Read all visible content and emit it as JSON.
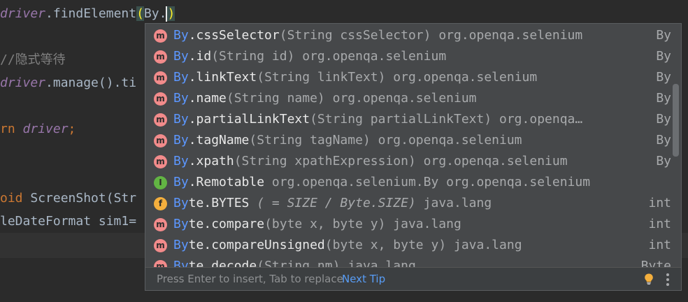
{
  "editor": {
    "lines": [
      {
        "prefix": "driver",
        "middle": ".findElement",
        "paren": "(",
        "after": "By."
      },
      {
        "comment": "//隐式等待"
      },
      {
        "prefix": "driver",
        "middle": ".manage().ti"
      },
      {
        "kw": "rn ",
        "var": "driver",
        "end": ";"
      },
      {
        "kw": "oid ",
        "rest": "ScreenShot(Str"
      },
      {
        "rest": "leDateFormat sim1="
      }
    ]
  },
  "completion": {
    "items": [
      {
        "icon": "m",
        "match": "By",
        "name": ".cssSelector",
        "sig": "(String cssSelector)",
        "tail": " org.openqa.selenium",
        "type": "By"
      },
      {
        "icon": "m",
        "match": "By",
        "name": ".id",
        "sig": "(String id)",
        "tail": " org.openqa.selenium",
        "type": "By"
      },
      {
        "icon": "m",
        "match": "By",
        "name": ".linkText",
        "sig": "(String linkText)",
        "tail": " org.openqa.selenium",
        "type": "By"
      },
      {
        "icon": "m",
        "match": "By",
        "name": ".name",
        "sig": "(String name)",
        "tail": " org.openqa.selenium",
        "type": "By"
      },
      {
        "icon": "m",
        "match": "By",
        "name": ".partialLinkText",
        "sig": "(String partialLinkText)",
        "tail": " org.openqa…",
        "type": "By"
      },
      {
        "icon": "m",
        "match": "By",
        "name": ".tagName",
        "sig": "(String tagName)",
        "tail": " org.openqa.selenium",
        "type": "By"
      },
      {
        "icon": "m",
        "match": "By",
        "name": ".xpath",
        "sig": "(String xpathExpression)",
        "tail": " org.openqa.selenium",
        "type": "By"
      },
      {
        "icon": "I",
        "match": "By",
        "name": ".Remotable",
        "sig": "",
        "tail": " org.openqa.selenium.By org.openqa.selenium",
        "type": ""
      },
      {
        "icon": "f",
        "match": "By",
        "name": "te.BYTES",
        "sig": " ( = SIZE / Byte.SIZE)",
        "tail": " java.lang",
        "type": "int"
      },
      {
        "icon": "m",
        "match": "By",
        "name": "te.compare",
        "sig": "(byte x, byte y)",
        "tail": " java.lang",
        "type": "int"
      },
      {
        "icon": "m",
        "match": "By",
        "name": "te.compareUnsigned",
        "sig": "(byte x, byte y)",
        "tail": " java.lang",
        "type": "int"
      },
      {
        "icon": "m",
        "match": "By",
        "name": "te.decode",
        "sig": "(String nm)",
        "tail": " java.lang",
        "type": "Byte"
      }
    ],
    "footer": {
      "hint": "Press Enter to insert, Tab to replace",
      "next_tip": "Next Tip"
    }
  },
  "colors": {
    "editor_bg": "#2b2b2b",
    "popup_bg": "#46484a",
    "selection": "#2f65ca",
    "match": "#5c97ff",
    "link": "#589df6"
  },
  "icons": {
    "method": "method-icon",
    "interface": "interface-icon",
    "field": "field-icon",
    "tip": "lightbulb-icon",
    "options": "more-options-icon"
  }
}
